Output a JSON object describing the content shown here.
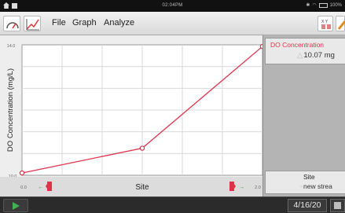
{
  "status_bar": {
    "time": "02:04PM",
    "battery": "100%"
  },
  "menu": {
    "file": "File",
    "graph": "Graph",
    "analyze": "Analyze"
  },
  "graph": {
    "y_axis_label": "DO Concentration (mg/L)",
    "y_max_label": "14.0",
    "y_min_label": "10.0",
    "x_axis_label": "Site",
    "x_min_label": "0.0",
    "x_max_label": "2.0",
    "line_color": "#e0324b"
  },
  "chart_data": {
    "type": "line",
    "x": [
      0,
      1,
      2
    ],
    "y": [
      10.07,
      10.83,
      13.95
    ],
    "xlim": [
      0,
      2
    ],
    "ylim": [
      10,
      14
    ],
    "xlabel": "Site",
    "ylabel": "DO Concentration (mg/L)",
    "grid": true
  },
  "meters": {
    "dd": {
      "label": "DO Concentration",
      "value": "10.07 mg"
    },
    "site": {
      "label": "Site",
      "value": "new strea"
    }
  },
  "bottom": {
    "date": "4/16/20"
  }
}
